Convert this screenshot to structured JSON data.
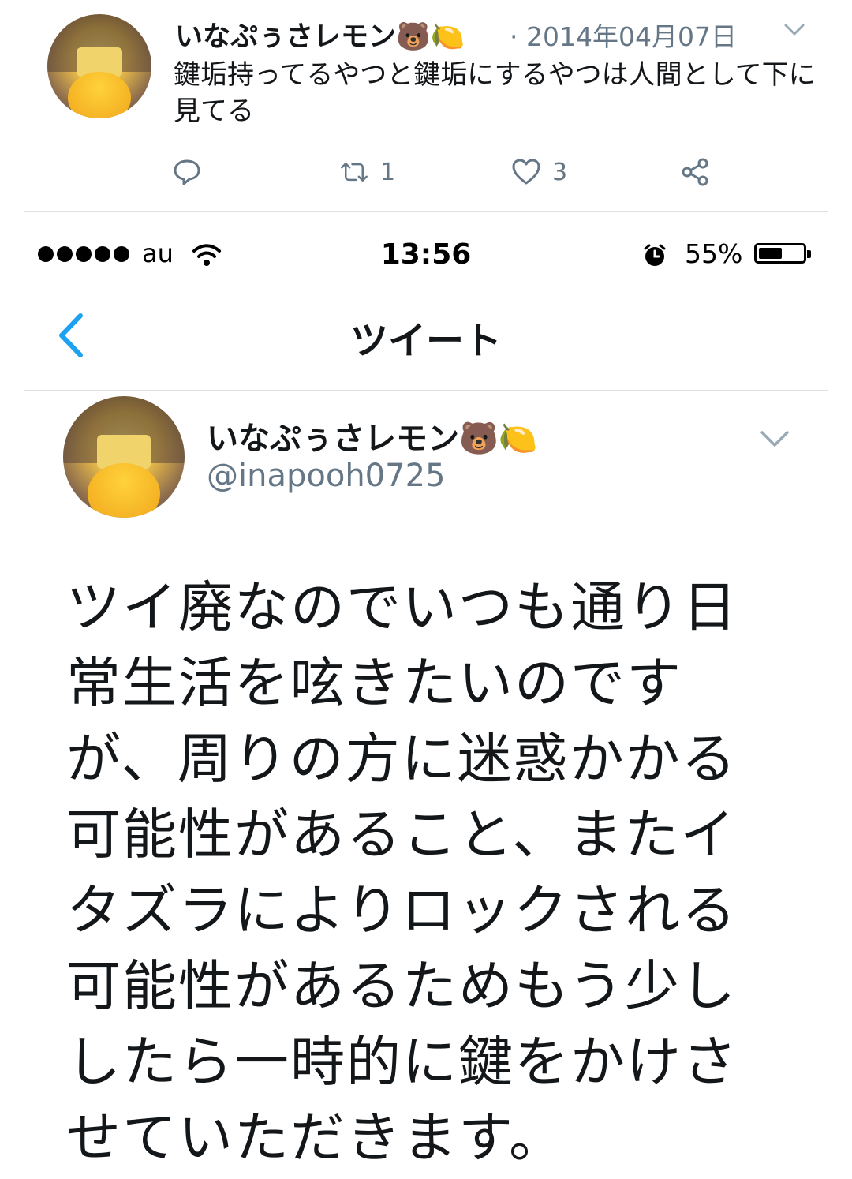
{
  "top_tweet": {
    "display_name": "いなぷぅさレモン🐻🍋",
    "date": "· 2014年04月07日",
    "text": "鍵垢持ってるやつと鍵垢にするやつは人間として下に見てる",
    "retweet_count": "1",
    "like_count": "3"
  },
  "status_bar": {
    "carrier": "au",
    "time": "13:56",
    "battery": "55%",
    "battery_level": 0.55
  },
  "nav": {
    "title": "ツイート"
  },
  "main_tweet": {
    "display_name": "いなぷぅさレモン🐻🍋",
    "handle": "@inapooh0725",
    "text": "ツイ廃なのでいつも通り日常生活を呟きたいのですが、周りの方に迷惑かかる可能性があること、またイタズラによりロックされる可能性があるためもう少ししたら一時的に鍵をかけさせていただきます。"
  },
  "colors": {
    "accent": "#1da1f2",
    "secondary_text": "#657786",
    "divider": "#dcdfe3"
  },
  "icons": [
    "reply-icon",
    "retweet-icon",
    "like-icon",
    "share-icon",
    "chevron-down-icon",
    "wifi-icon",
    "alarm-icon",
    "battery-icon",
    "back-chevron-icon"
  ]
}
